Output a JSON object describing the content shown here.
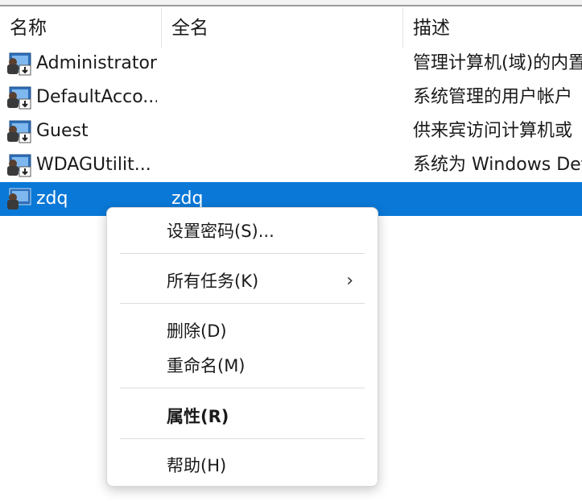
{
  "header": {
    "col_name": "名称",
    "col_fullname": "全名",
    "col_description": "描述"
  },
  "users": [
    {
      "name": "Administrator",
      "fullname": "",
      "description": "管理计算机(域)的内置",
      "icon": "user-disabled-icon"
    },
    {
      "name": "DefaultAcco...",
      "fullname": "",
      "description": "系统管理的用户帐户",
      "icon": "user-disabled-icon"
    },
    {
      "name": "Guest",
      "fullname": "",
      "description": "供来宾访问计算机或",
      "icon": "user-disabled-icon"
    },
    {
      "name": "WDAGUtilit...",
      "fullname": "",
      "description": "系统为 Windows Def",
      "icon": "user-disabled-icon"
    },
    {
      "name": "zdq",
      "fullname": "zdq",
      "description": "",
      "icon": "user-icon",
      "selected": true
    }
  ],
  "context_menu": {
    "set_password": "设置密码(S)...",
    "all_tasks": "所有任务(K)",
    "all_tasks_arrow": "›",
    "delete": "删除(D)",
    "rename": "重命名(M)",
    "properties": "属性(R)",
    "help": "帮助(H)"
  },
  "colors": {
    "selection": "#0a78d7",
    "menu_bg": "#ffffff"
  }
}
